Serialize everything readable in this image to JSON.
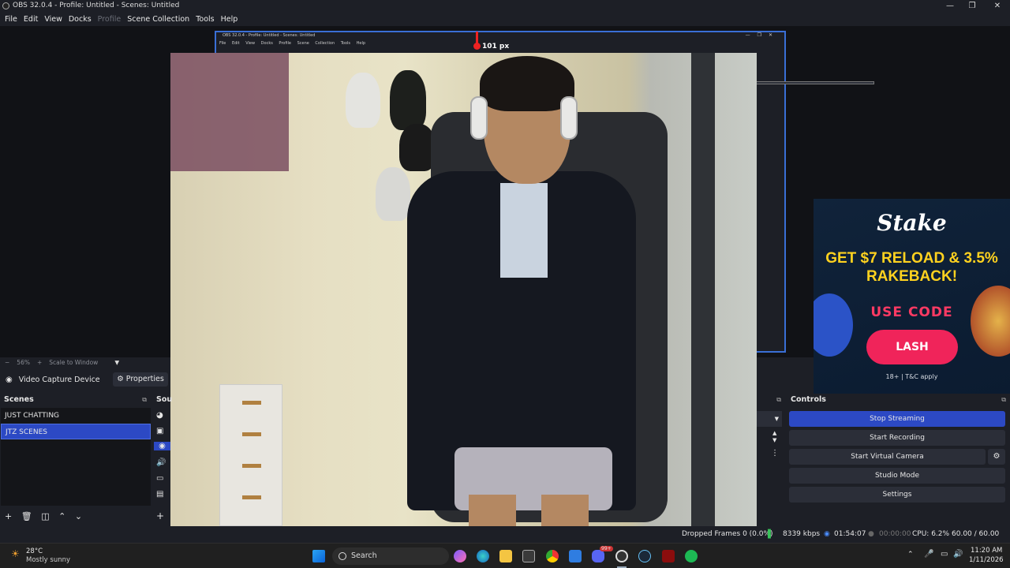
{
  "window": {
    "title": "OBS 32.0.4 - Profile: Untitled - Scenes: Untitled"
  },
  "menu": [
    "File",
    "Edit",
    "View",
    "Docks",
    "Profile",
    "Scene Collection",
    "Tools",
    "Help"
  ],
  "preview": {
    "nested_title": "OBS 32.0.4 - Profile: Untitled - Scenes: Untitled",
    "nested_menu": "File Edit View Docks Profile Scene Collection Tools Help",
    "measure_label": "101 px",
    "zoom": "56%",
    "scale_mode": "Scale to Window"
  },
  "ad": {
    "logo": "Stake",
    "headline": "GET $7 RELOAD & 3.5% RAKEBACK!",
    "use_code": "USE CODE",
    "code": "LASH",
    "terms": "18+ | T&C apply"
  },
  "source_toolbar": {
    "source_name": "Video Capture Device",
    "properties": "Properties"
  },
  "scenes": {
    "title": "Scenes",
    "items": [
      "JUST CHATTING",
      "JTZ SCENES"
    ],
    "selected": "JTZ SCENES"
  },
  "sources": {
    "title": "Sou"
  },
  "controls": {
    "title": "Controls",
    "stop_streaming": "Stop Streaming",
    "start_recording": "Start Recording",
    "start_virtual_camera": "Start Virtual Camera",
    "studio_mode": "Studio Mode",
    "settings": "Settings"
  },
  "status": {
    "dropped_frames": "Dropped Frames 0 (0.0%)",
    "bitrate": "8339 kbps",
    "stream_time": "01:54:07",
    "record_time": "00:00:00",
    "cpu": "CPU: 6.2%",
    "fps": "60.00 / 60.00 FPS"
  },
  "taskbar": {
    "weather_temp": "28°C",
    "weather_desc": "Mostly sunny",
    "search": "Search",
    "time": "11:20 AM",
    "date": "1/11/2026",
    "badge_count": "99+"
  },
  "colors": {
    "accent": "#2c49c4",
    "bg": "#1d1f26",
    "ad_yellow": "#ffd21f",
    "ad_pink": "#f0245a"
  }
}
